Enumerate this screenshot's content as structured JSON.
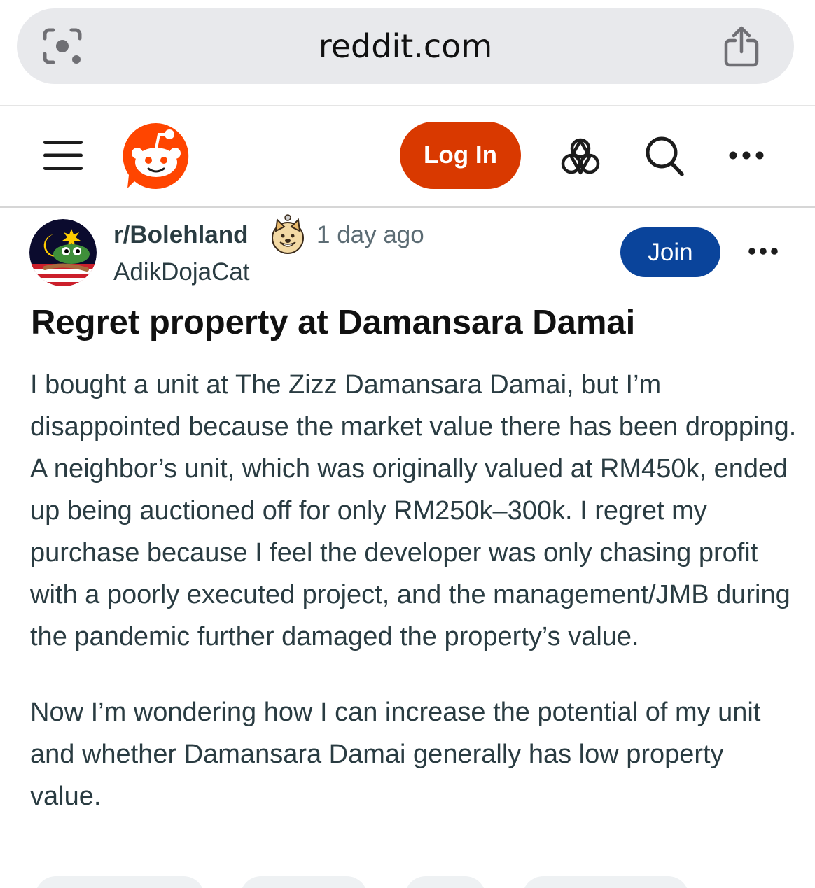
{
  "browser": {
    "url": "reddit.com",
    "icons": {
      "lens": "visual-lookup-icon",
      "share": "share-icon"
    }
  },
  "header": {
    "login_label": "Log In",
    "brand_color": "#d93900",
    "icons": [
      "menu-icon",
      "reddit-logo",
      "get-app-icon",
      "search-icon",
      "more-icon"
    ]
  },
  "post": {
    "subreddit": "r/Bolehland",
    "time": "1 day ago",
    "author": "AdikDojaCat",
    "join_label": "Join",
    "join_color": "#0a449b",
    "title": "Regret property at Damansara Damai",
    "body": [
      "I bought a unit at The Zizz Damansara Damai, but I’m disappointed because the market value there has been dropping. A neighbor’s unit, which was originally valued at RM450k, ended up being auctioned off for only RM250k–300k. I regret my purchase because I feel the developer was only chasing profit with a poorly executed project, and the management/JMB during the pandemic further damaged the property’s value.",
      "Now I’m wondering how I can increase the potential of my unit and whether Damansara Damai generally has low property value."
    ]
  }
}
